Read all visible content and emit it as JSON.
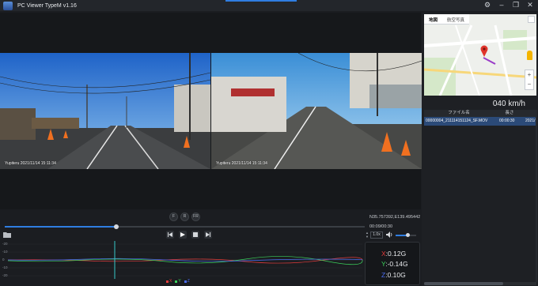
{
  "window": {
    "title": "PC Viewer TypeM v1.16",
    "buttons": [
      "settings-icon",
      "minimize-icon",
      "restore-icon",
      "close-icon"
    ]
  },
  "cameras": {
    "front": {
      "stamp": "Yupiteru 2021/11/14 15:11:34"
    },
    "rear": {
      "stamp": "Yupiteru 2021/11/14 15:11:34"
    }
  },
  "player": {
    "view_buttons": [
      "F",
      "R",
      "FR"
    ],
    "coords": "N35.757392,E139.495442",
    "timecode": "00:09/00:30",
    "progress": 0.31,
    "playback_speed": "1.0x",
    "volume": 0.6
  },
  "gsensor": {
    "axis_labels": [
      "-20",
      "-10",
      "0",
      "-10",
      "-20"
    ],
    "legend": [
      {
        "name": "X",
        "color": "#e23b3b"
      },
      {
        "name": "Y",
        "color": "#3bcf5a"
      },
      {
        "name": "Z",
        "color": "#4a6cf0"
      }
    ],
    "readout": [
      {
        "axis": "X",
        "value": ":0.12G",
        "color": "#e23b3b"
      },
      {
        "axis": "Y",
        "value": ":-0.14G",
        "color": "#3bcf5a"
      },
      {
        "axis": "Z",
        "value": ":0.10G",
        "color": "#4a6cf0"
      }
    ]
  },
  "map": {
    "tabs": [
      "地図",
      "航空写真"
    ],
    "active_tab": "地図"
  },
  "speed": "040 km/h",
  "file_list": {
    "columns": [
      "ファイル名",
      "長さ"
    ],
    "rows": [
      {
        "name": "00000004_211114151124_SF.MOV",
        "length": "00:00:30",
        "date": "2021/"
      }
    ]
  },
  "colors": {
    "accent": "#2f7de1",
    "background": "#1b1d21",
    "selected_row": "#2b4a78"
  }
}
